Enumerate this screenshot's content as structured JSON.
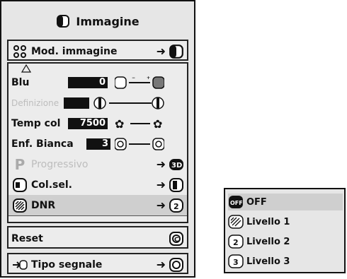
{
  "menu": {
    "title": "Immagine",
    "items": [
      {
        "label": "Mod. immagine",
        "arrow": "➜"
      },
      {
        "label": "Blu",
        "value": "0"
      },
      {
        "label": "Definizione",
        "value": ""
      },
      {
        "label": "Temp col",
        "value": "7500"
      },
      {
        "label": "Enf. Bianca",
        "value": "3"
      },
      {
        "label": "Progressivo",
        "arrow": "➜"
      },
      {
        "label": "Col.sel.",
        "arrow": "➜"
      },
      {
        "label": "DNR",
        "arrow": "➜"
      },
      {
        "label": "Reset"
      },
      {
        "label": "Tipo segnale",
        "arrow": "➜"
      }
    ],
    "scroll_up_icon": "triangle-up-icon"
  },
  "submenu": {
    "options": [
      {
        "label": "OFF"
      },
      {
        "label": "Livello 1"
      },
      {
        "label": "Livello 2"
      },
      {
        "label": "Livello 3"
      }
    ]
  }
}
